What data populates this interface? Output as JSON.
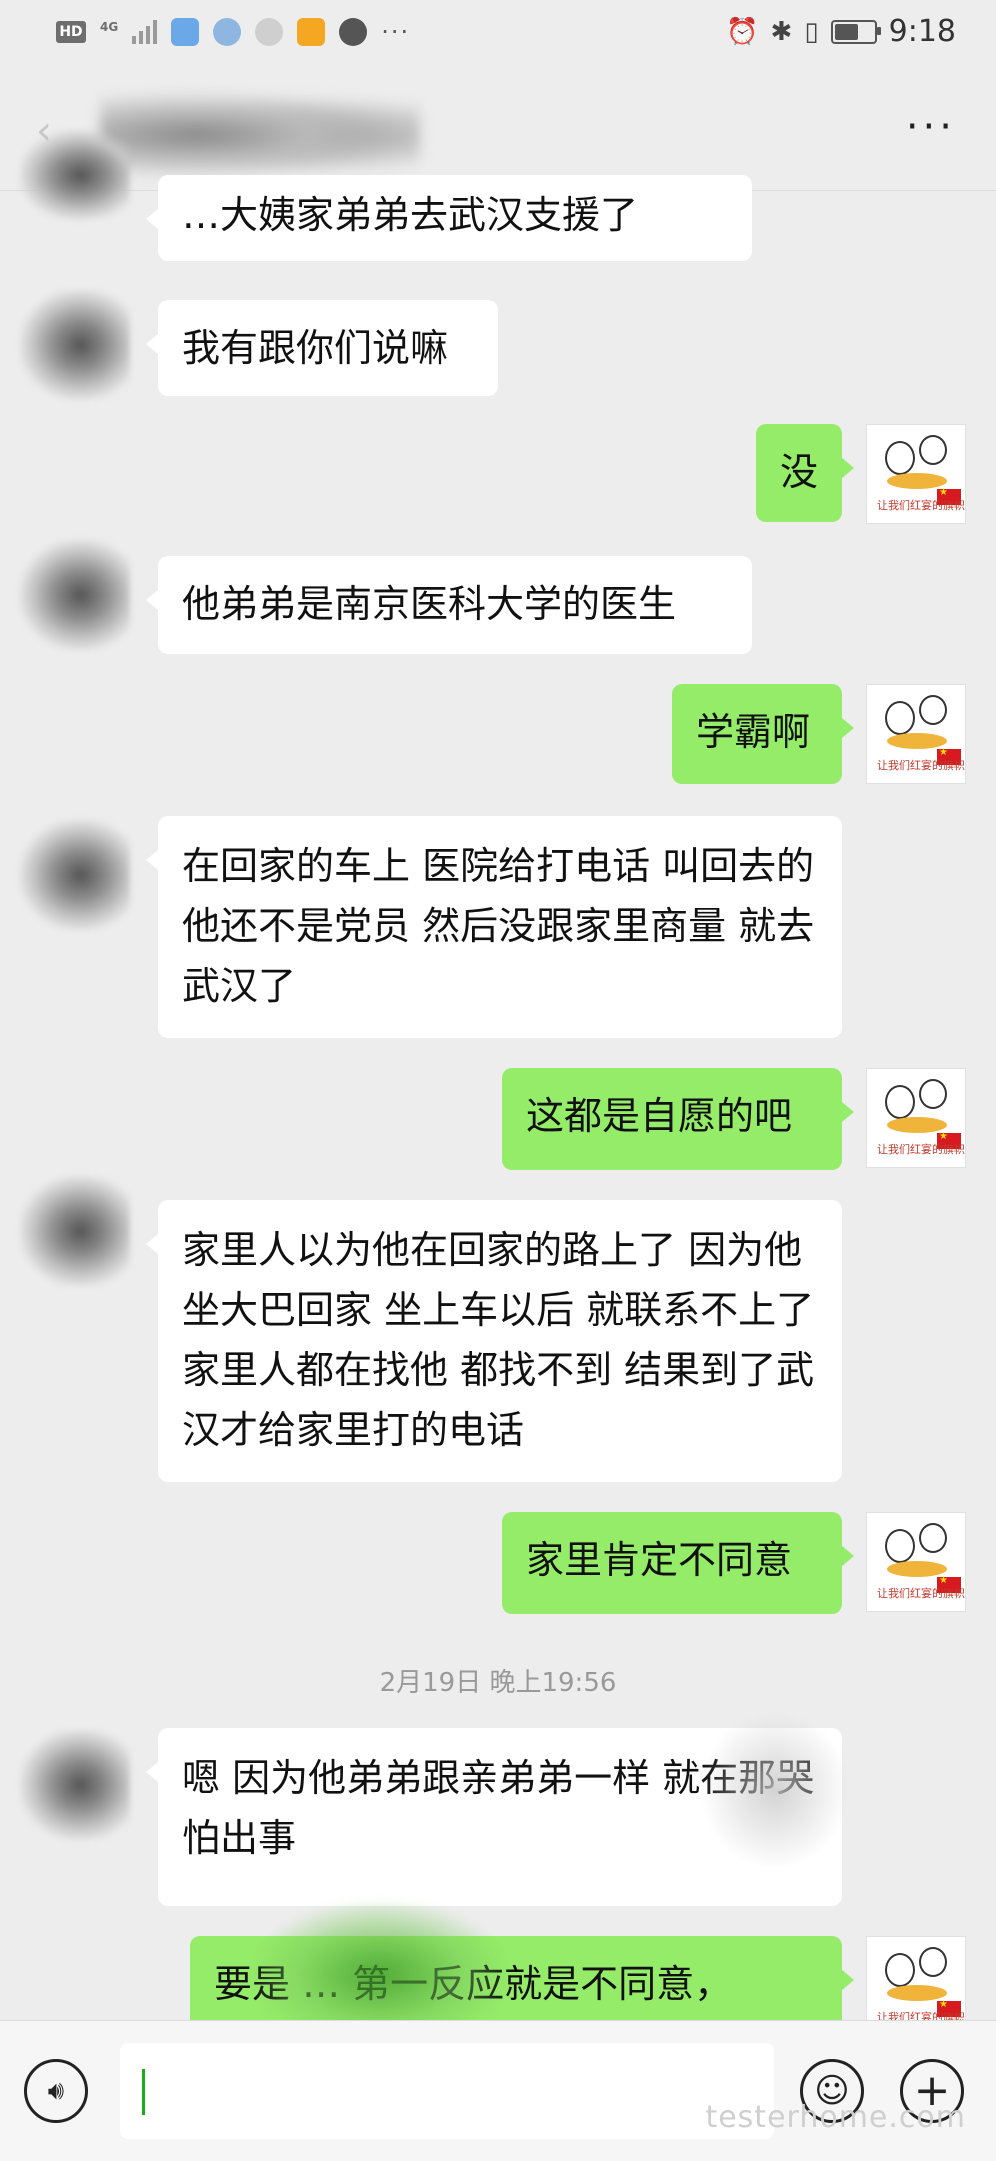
{
  "status_bar": {
    "hd": "HD",
    "network": "4G",
    "time": "9:18"
  },
  "nav": {
    "more": "···"
  },
  "messages": [
    {
      "side": "left",
      "text": "…大姨家弟弟去武汉支援了"
    },
    {
      "side": "left",
      "text": "我有跟你们说嘛"
    },
    {
      "side": "right",
      "text": "没"
    },
    {
      "side": "left",
      "text": "他弟弟是南京医科大学的医生"
    },
    {
      "side": "right",
      "text": "学霸啊"
    },
    {
      "side": "left",
      "text": "在回家的车上 医院给打电话 叫回去的 他还不是党员  然后没跟家里商量 就去武汉了"
    },
    {
      "side": "right",
      "text": "这都是自愿的吧"
    },
    {
      "side": "left",
      "text": "家里人以为他在回家的路上了 因为他坐大巴回家 坐上车以后 就联系不上了 家里人都在找他 都找不到 结果到了武汉才给家里打的电话"
    },
    {
      "side": "right",
      "text": "家里肯定不同意"
    },
    {
      "side": "left",
      "text": "嗯  因为他弟弟跟亲弟弟一样 就在那哭 怕出事"
    },
    {
      "side": "right",
      "text": "要是 … 第一反应就是不同意，"
    }
  ],
  "timestamp": "2月19日 晚上19:56",
  "avatar_caption": "让我们红宴的旗帜飘扬",
  "input": {
    "value": ""
  },
  "watermark": "testerhome.com",
  "colors": {
    "background": "#ededed",
    "bubble_left": "#ffffff",
    "bubble_right": "#95ec69",
    "cursor": "#1aad19"
  },
  "icons": [
    "back-icon",
    "more-icon",
    "voice-icon",
    "emoji-icon",
    "plus-icon"
  ]
}
